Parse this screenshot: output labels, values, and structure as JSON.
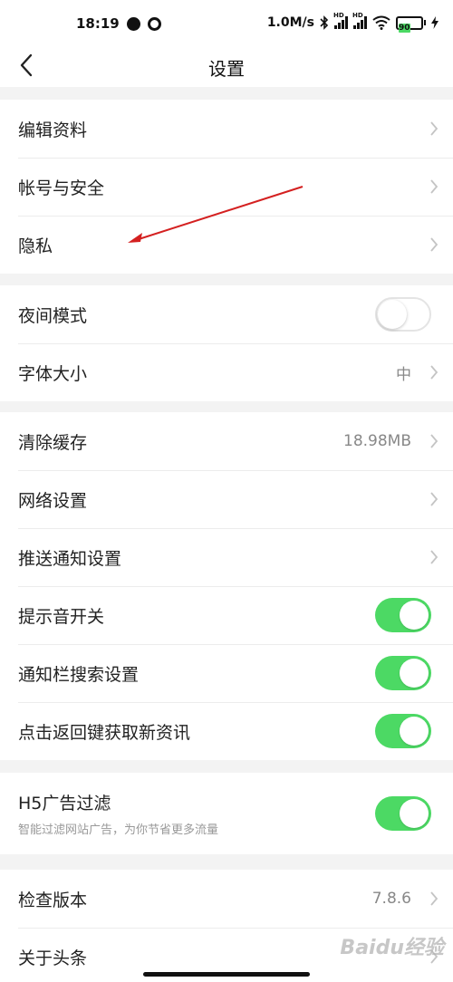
{
  "status_bar": {
    "time": "18:19",
    "net_speed": "1.0M/s",
    "battery": "90",
    "hd": "HD"
  },
  "header": {
    "title": "设置"
  },
  "groups": {
    "account": [
      {
        "label": "编辑资料"
      },
      {
        "label": "帐号与安全"
      },
      {
        "label": "隐私"
      }
    ],
    "display": [
      {
        "label": "夜间模式",
        "toggle": false
      },
      {
        "label": "字体大小",
        "value": "中"
      }
    ],
    "general": [
      {
        "label": "清除缓存",
        "value": "18.98MB"
      },
      {
        "label": "网络设置"
      },
      {
        "label": "推送通知设置"
      },
      {
        "label": "提示音开关",
        "toggle": true
      },
      {
        "label": "通知栏搜索设置",
        "toggle": true
      },
      {
        "label": "点击返回键获取新资讯",
        "toggle": true
      }
    ],
    "ad": [
      {
        "label": "H5广告过滤",
        "subtitle": "智能过滤网站广告，为你节省更多流量",
        "toggle": true
      }
    ],
    "about": [
      {
        "label": "检查版本",
        "value": "7.8.6"
      },
      {
        "label": "关于头条"
      }
    ]
  },
  "colors": {
    "toggle_on": "#4cd964",
    "arrow": "#d42020"
  },
  "watermark": "Baidu经验"
}
